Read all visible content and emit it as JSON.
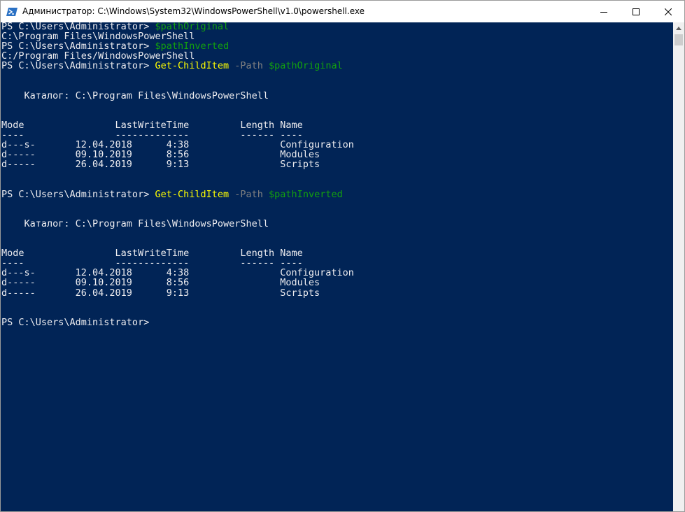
{
  "window": {
    "title": "Администратор: C:\\Windows\\System32\\WindowsPowerShell\\v1.0\\powershell.exe",
    "icon": "powershell-icon",
    "controls": [
      "minimize-icon",
      "maximize-icon",
      "close-icon"
    ]
  },
  "colors": {
    "background": "#012456",
    "text": "#eeedf0",
    "command": "#ffff00",
    "variable": "#13a10e",
    "parameter": "#808080"
  },
  "terminal": {
    "lines": [
      [
        {
          "t": "PS C:\\Users\\Administrator> ",
          "c": "out"
        },
        {
          "t": "$pathOriginal",
          "c": "var"
        }
      ],
      [
        {
          "t": "C:\\Program Files\\WindowsPowerShell",
          "c": "out"
        }
      ],
      [
        {
          "t": "PS C:\\Users\\Administrator> ",
          "c": "out"
        },
        {
          "t": "$pathInverted",
          "c": "var"
        }
      ],
      [
        {
          "t": "C:/Program Files/WindowsPowerShell",
          "c": "out"
        }
      ],
      [
        {
          "t": "PS C:\\Users\\Administrator> ",
          "c": "out"
        },
        {
          "t": "Get-ChildItem",
          "c": "cmd"
        },
        {
          "t": " ",
          "c": "out"
        },
        {
          "t": "-Path",
          "c": "param"
        },
        {
          "t": " ",
          "c": "out"
        },
        {
          "t": "$pathOriginal",
          "c": "var"
        }
      ],
      [],
      [],
      [
        {
          "t": "    Каталог: C:\\Program Files\\WindowsPowerShell",
          "c": "out"
        }
      ],
      [],
      [],
      [
        {
          "t": "Mode                LastWriteTime         Length Name",
          "c": "out"
        }
      ],
      [
        {
          "t": "----                -------------         ------ ----",
          "c": "out"
        }
      ],
      [
        {
          "t": "d---s-       12.04.2018      4:38                Configuration",
          "c": "out"
        }
      ],
      [
        {
          "t": "d-----       09.10.2019      8:56                Modules",
          "c": "out"
        }
      ],
      [
        {
          "t": "d-----       26.04.2019      9:13                Scripts",
          "c": "out"
        }
      ],
      [],
      [],
      [
        {
          "t": "PS C:\\Users\\Administrator> ",
          "c": "out"
        },
        {
          "t": "Get-ChildItem",
          "c": "cmd"
        },
        {
          "t": " ",
          "c": "out"
        },
        {
          "t": "-Path",
          "c": "param"
        },
        {
          "t": " ",
          "c": "out"
        },
        {
          "t": "$pathInverted",
          "c": "var"
        }
      ],
      [],
      [],
      [
        {
          "t": "    Каталог: C:\\Program Files\\WindowsPowerShell",
          "c": "out"
        }
      ],
      [],
      [],
      [
        {
          "t": "Mode                LastWriteTime         Length Name",
          "c": "out"
        }
      ],
      [
        {
          "t": "----                -------------         ------ ----",
          "c": "out"
        }
      ],
      [
        {
          "t": "d---s-       12.04.2018      4:38                Configuration",
          "c": "out"
        }
      ],
      [
        {
          "t": "d-----       09.10.2019      8:56                Modules",
          "c": "out"
        }
      ],
      [
        {
          "t": "d-----       26.04.2019      9:13                Scripts",
          "c": "out"
        }
      ],
      [],
      [],
      [
        {
          "t": "PS C:\\Users\\Administrator>",
          "c": "out"
        }
      ]
    ]
  }
}
